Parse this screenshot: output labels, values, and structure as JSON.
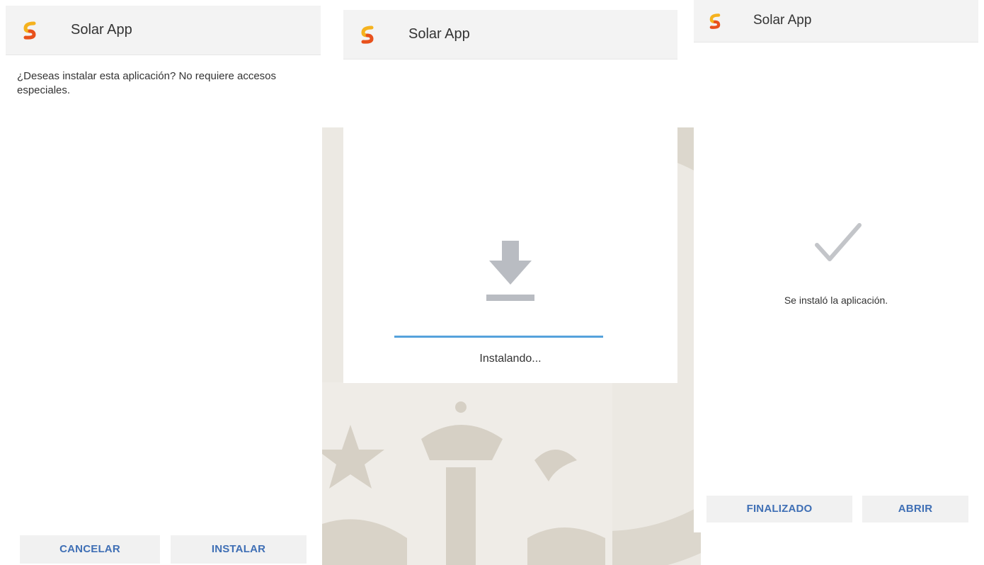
{
  "app": {
    "name": "Solar App",
    "icon": "solar-app-logo-icon",
    "accent_color": "#3f6fb5",
    "icon_colors": [
      "#f5b21e",
      "#e8511c"
    ]
  },
  "screen_confirm": {
    "prompt": "¿Deseas instalar esta aplicación? No requiere accesos especiales.",
    "cancel_label": "CANCELAR",
    "install_label": "INSTALAR"
  },
  "screen_installing": {
    "icon": "download-icon",
    "status": "Instalando...",
    "progress": 1.0,
    "progress_color": "#56a2dc"
  },
  "screen_done": {
    "icon": "checkmark-icon",
    "message": "Se instaló la aplicación.",
    "finish_label": "FINALIZADO",
    "open_label": "ABRIR"
  }
}
